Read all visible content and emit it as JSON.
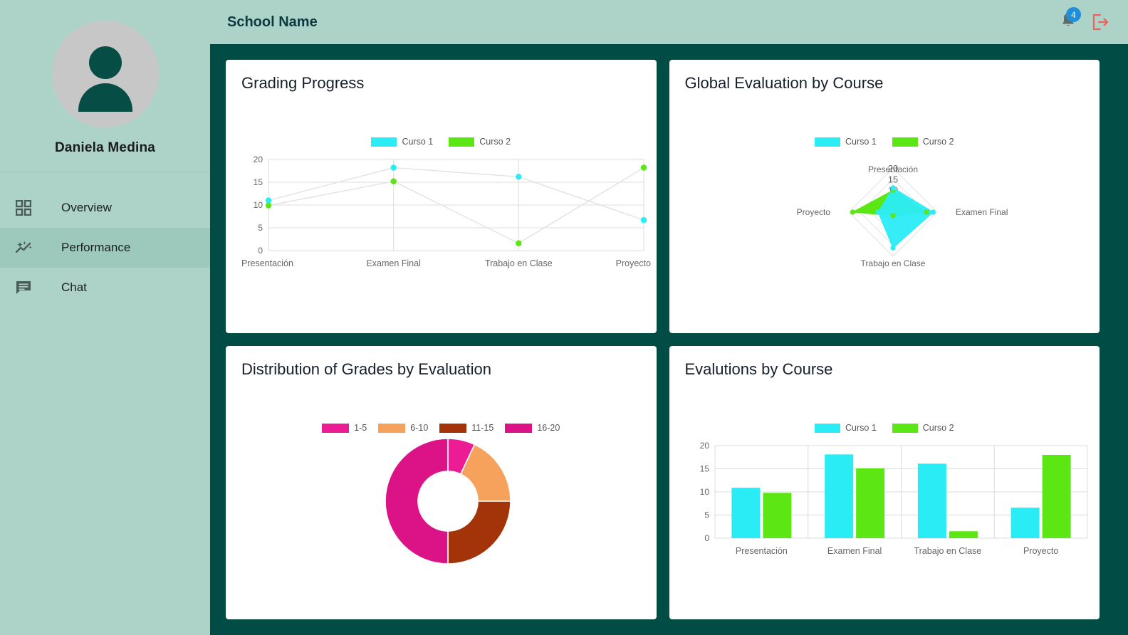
{
  "sidebar": {
    "profile": {
      "name": "Daniela Medina",
      "avatar_icon": "person-icon"
    },
    "items": [
      {
        "label": "Overview",
        "icon": "grid-icon",
        "active": false
      },
      {
        "label": "Performance",
        "icon": "sparkle-chart-icon",
        "active": true
      },
      {
        "label": "Chat",
        "icon": "chat-bubble-icon",
        "active": false
      }
    ]
  },
  "topbar": {
    "title": "School Name",
    "bell_icon": "bell-icon",
    "notification_count": "4",
    "logout_icon": "logout-icon"
  },
  "colors": {
    "sidebar_bg": "#ADD3C8",
    "main_bg": "#014C45",
    "accent_dark": "#054D45",
    "curso1": "#2AECF5",
    "curso2": "#5CE614",
    "badge": "#1E8FDB",
    "logout": "#F2605B",
    "grade_1_5": "#EC1C95",
    "grade_6_10": "#F7A25C",
    "grade_11_15": "#A33409",
    "grade_16_20": "#DC1287"
  },
  "cards": {
    "grading_progress": {
      "title": "Grading Progress"
    },
    "global_evaluation": {
      "title": "Global Evaluation by Course"
    },
    "distribution": {
      "title": "Distribution of Grades by Evaluation"
    },
    "evaluations": {
      "title": "Evalutions by Course"
    }
  },
  "chart_data": [
    {
      "id": "grading-progress",
      "type": "line",
      "title": "Grading Progress",
      "categories": [
        "Presentación",
        "Examen Final",
        "Trabajo en Clase",
        "Proyecto"
      ],
      "series": [
        {
          "name": "Curso 1",
          "color": "#2AECF5",
          "values": [
            11.0,
            18.2,
            16.2,
            6.7
          ]
        },
        {
          "name": "Curso 2",
          "color": "#5CE614",
          "values": [
            9.9,
            15.2,
            1.6,
            18.2
          ]
        }
      ],
      "yticks": [
        "0",
        "5",
        "10",
        "15",
        "20"
      ],
      "ylim": [
        0,
        20
      ],
      "xlabel": "",
      "ylabel": "",
      "grid": true,
      "legend_position": "top"
    },
    {
      "id": "global-evaluation",
      "type": "radar",
      "title": "Global Evaluation by Course",
      "categories": [
        "Presentación",
        "Examen Final",
        "Trabajo en Clase",
        "Proyecto"
      ],
      "series": [
        {
          "name": "Curso 1",
          "color": "#2AECF5",
          "values": [
            11.0,
            18.2,
            16.2,
            6.7
          ]
        },
        {
          "name": "Curso 2",
          "color": "#5CE614",
          "values": [
            9.9,
            15.2,
            1.6,
            18.2
          ]
        }
      ],
      "rticks": [
        "20",
        "15",
        "10"
      ],
      "rlim": [
        0,
        20
      ],
      "grid": true,
      "legend_position": "top"
    },
    {
      "id": "distribution-of-grades",
      "type": "pie",
      "title": "Distribution of Grades by Evaluation",
      "donut": true,
      "labels": [
        "1-5",
        "6-10",
        "11-15",
        "16-20"
      ],
      "values": [
        7,
        18,
        25,
        50
      ],
      "colors": [
        "#EC1C95",
        "#F7A25C",
        "#A33409",
        "#DC1287"
      ],
      "legend_position": "top"
    },
    {
      "id": "evaluations-by-course",
      "type": "bar",
      "title": "Evalutions by Course",
      "categories": [
        "Presentación",
        "Examen Final",
        "Trabajo en Clase",
        "Proyecto"
      ],
      "series": [
        {
          "name": "Curso 1",
          "color": "#2AECF5",
          "values": [
            10.9,
            18.1,
            16.1,
            6.6
          ]
        },
        {
          "name": "Curso 2",
          "color": "#5CE614",
          "values": [
            9.8,
            15.1,
            1.5,
            18.0
          ]
        }
      ],
      "yticks": [
        "0",
        "5",
        "10",
        "15",
        "20"
      ],
      "ylim": [
        0,
        20
      ],
      "xlabel": "",
      "ylabel": "",
      "grid": true,
      "legend_position": "top"
    }
  ]
}
